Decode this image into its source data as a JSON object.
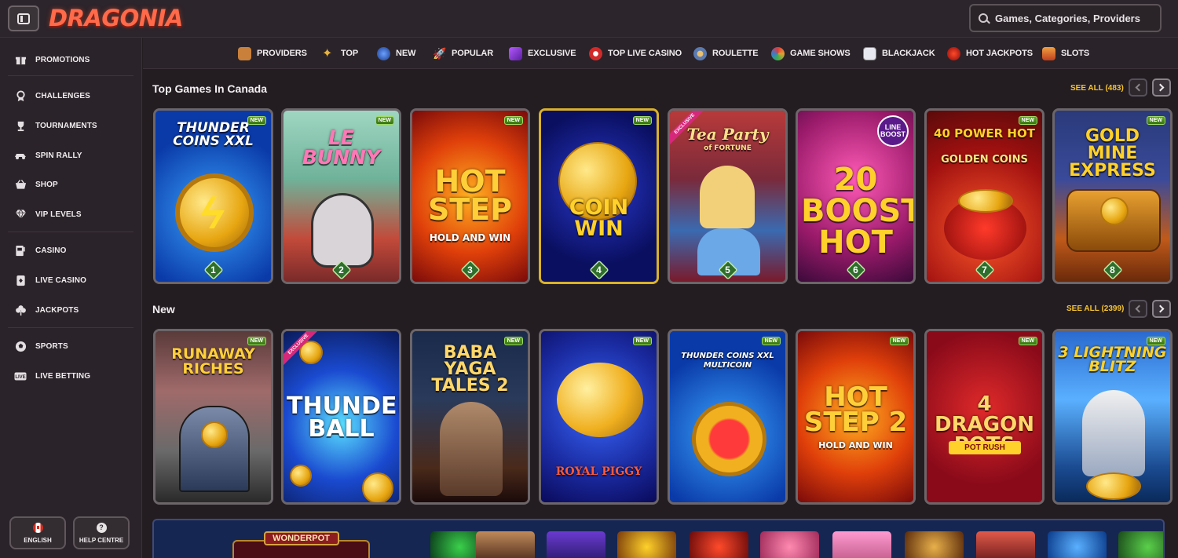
{
  "header": {
    "logo": "DRAGONIA",
    "search_placeholder": "Games, Categories, Providers"
  },
  "sidebar": {
    "items": [
      {
        "label": "PROMOTIONS",
        "icon": "gift-icon"
      },
      {
        "label": "CHALLENGES",
        "icon": "medal-icon"
      },
      {
        "label": "TOURNAMENTS",
        "icon": "trophy-icon"
      },
      {
        "label": "SPIN RALLY",
        "icon": "rally-car-icon"
      },
      {
        "label": "SHOP",
        "icon": "shopping-basket-icon"
      },
      {
        "label": "VIP LEVELS",
        "icon": "diamond-icon"
      },
      {
        "label": "CASINO",
        "icon": "slot-machine-icon"
      },
      {
        "label": "LIVE CASINO",
        "icon": "playing-card-icon"
      },
      {
        "label": "JACKPOTS",
        "icon": "clover-icon"
      },
      {
        "label": "SPORTS",
        "icon": "soccer-ball-icon"
      },
      {
        "label": "LIVE BETTING",
        "icon": "live-icon"
      }
    ],
    "language_label": "ENGLISH",
    "help_label": "HELP CENTRE"
  },
  "categories": [
    {
      "label": "PROVIDERS",
      "icon": "providers-icon",
      "color": "#c9803a"
    },
    {
      "label": "TOP",
      "icon": "star-icon",
      "color": "#e8b23a"
    },
    {
      "label": "NEW",
      "icon": "globe-icon",
      "color": "#3a6fd0"
    },
    {
      "label": "POPULAR",
      "icon": "rocket-icon",
      "color": "#d04a4a"
    },
    {
      "label": "EXCLUSIVE",
      "icon": "gem-icon",
      "color": "#8a3ad0"
    },
    {
      "label": "TOP LIVE CASINO",
      "icon": "live-casino-icon",
      "color": "#d02a2a"
    },
    {
      "label": "ROULETTE",
      "icon": "roulette-icon",
      "color": "#5a7ab0"
    },
    {
      "label": "GAME SHOWS",
      "icon": "wheel-icon",
      "color": "#e0a030"
    },
    {
      "label": "BLACKJACK",
      "icon": "cards-icon",
      "color": "#d8d8e8"
    },
    {
      "label": "HOT JACKPOTS",
      "icon": "chili-icon",
      "color": "#d02020"
    },
    {
      "label": "SLOTS",
      "icon": "slots-icon",
      "color": "#e06a30"
    }
  ],
  "sections": {
    "top": {
      "title": "Top Games In Canada",
      "see_all": "SEE ALL (483)"
    },
    "new": {
      "title": "New",
      "see_all": "SEE ALL (2399)"
    }
  },
  "top_games": [
    {
      "title": "THUNDER COINS XXL",
      "badge": "NEW",
      "rank": "1"
    },
    {
      "title": "LE BUNNY",
      "badge": "NEW",
      "rank": "2"
    },
    {
      "title": "HOT STEP",
      "subtitle": "HOLD AND WIN",
      "badge": "NEW",
      "rank": "3"
    },
    {
      "title": "COIN WIN",
      "badge": "NEW",
      "rank": "4"
    },
    {
      "title": "Tea Party",
      "subtitle": "of FORTUNE",
      "ribbon": "EXCLUSIVE",
      "rank": "5"
    },
    {
      "title": "20 BOOST HOT",
      "tag": "LINE BOOST",
      "rank": "6"
    },
    {
      "title": "40 POWER HOT",
      "subtitle": "GOLDEN COINS",
      "badge": "NEW",
      "rank": "7"
    },
    {
      "title": "GOLD MINE EXPRESS",
      "badge": "NEW",
      "rank": "8"
    }
  ],
  "new_games": [
    {
      "title": "RUNAWAY RICHES",
      "badge": "NEW"
    },
    {
      "title": "THUNDER BALL",
      "ribbon": "EXCLUSIVE"
    },
    {
      "title": "BABA YAGA TALES 2",
      "badge": "NEW"
    },
    {
      "title": "ROYAL PIGGY",
      "badge": "NEW"
    },
    {
      "title": "THUNDER COINS XXL MULTICOIN",
      "badge": "NEW"
    },
    {
      "title": "HOT STEP 2",
      "subtitle": "HOLD AND WIN",
      "badge": "NEW"
    },
    {
      "title": "4 DRAGON POTS",
      "subtitle": "POT RUSH",
      "badge": "NEW"
    },
    {
      "title": "3 LIGHTNING BLITZ",
      "badge": "NEW"
    }
  ],
  "jackpot": {
    "label": "WONDERPOT"
  }
}
